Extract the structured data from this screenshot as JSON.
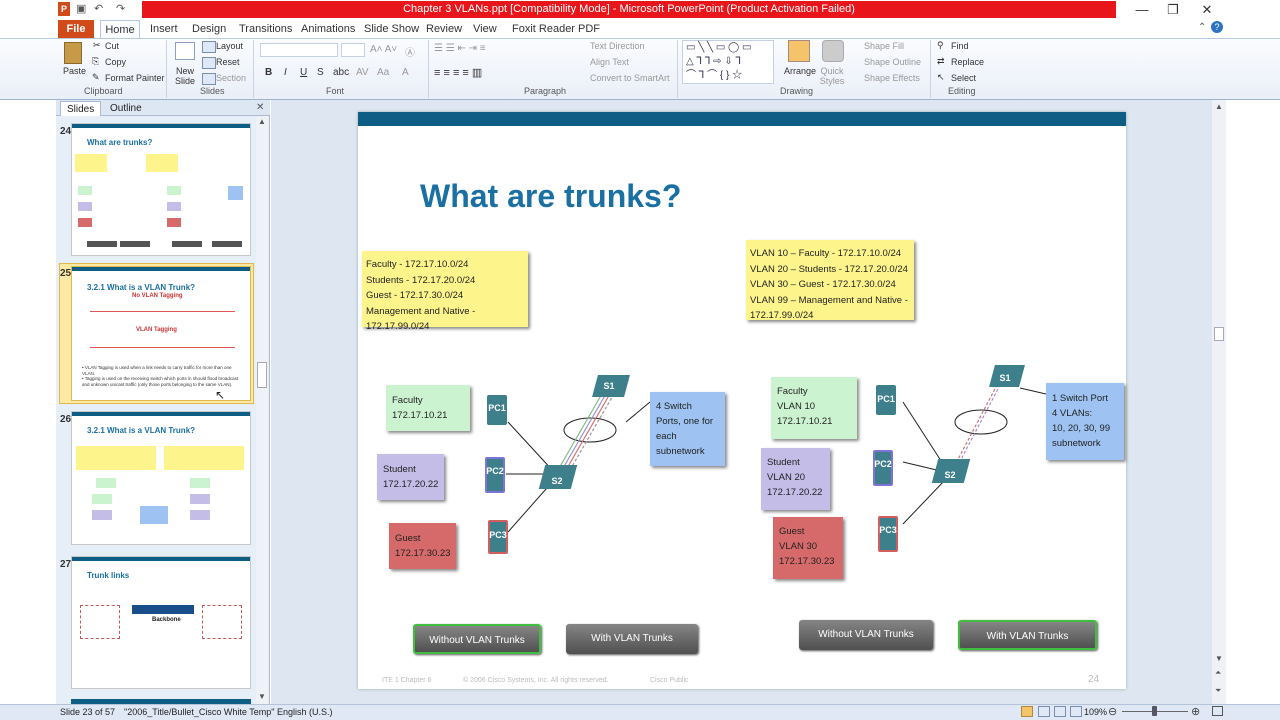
{
  "window": {
    "title": "Chapter 3 VLANs.ppt [Compatibility Mode] - Microsoft PowerPoint (Product Activation Failed)",
    "controls": [
      "—",
      "❐",
      "✕"
    ],
    "title_color": "#e8151b"
  },
  "ribbon_tabs": [
    "File",
    "Home",
    "Insert",
    "Design",
    "Transitions",
    "Animations",
    "Slide Show",
    "Review",
    "View",
    "Foxit Reader PDF"
  ],
  "clipboard": {
    "paste": "Paste",
    "cut": "Cut",
    "copy": "Copy",
    "format_painter": "Format Painter",
    "group": "Clipboard"
  },
  "slides_group": {
    "new_slide": "New Slide",
    "layout": "Layout",
    "reset": "Reset",
    "section": "Section",
    "group": "Slides"
  },
  "font_group": {
    "group": "Font",
    "bold": "B",
    "italic": "I",
    "underline": "U",
    "strike": "S",
    "shadow": "abc"
  },
  "paragraph_group": {
    "text_direction": "Text Direction",
    "align_text": "Align Text",
    "convert_smartart": "Convert to SmartArt",
    "group": "Paragraph"
  },
  "drawing_group": {
    "arrange": "Arrange",
    "quick_styles": "Quick Styles",
    "shape_fill": "Shape Fill",
    "shape_outline": "Shape Outline",
    "shape_effects": "Shape Effects",
    "group": "Drawing"
  },
  "editing_group": {
    "find": "Find",
    "replace": "Replace",
    "select": "Select",
    "group": "Editing"
  },
  "pane_tabs": [
    "Slides",
    "Outline"
  ],
  "thumbnails": [
    {
      "num": "24",
      "title": "What are trunks?"
    },
    {
      "num": "25",
      "title": "3.2.1 What is a VLAN Trunk?",
      "sub1": "No VLAN Tagging",
      "sub2": "VLAN Tagging",
      "bullets": [
        "VLAN Tagging is used when a link needs to carry traffic for more than one VLAN.",
        "Tagging is used on the receiving switch which ports in should flood broadcast and unknown unicast traffic (only those ports belonging to the same VLAN)."
      ]
    },
    {
      "num": "26",
      "title": "3.2.1 What is a VLAN Trunk?"
    },
    {
      "num": "27",
      "title": "Trunk links",
      "backbone": "Backbone"
    }
  ],
  "slide": {
    "title": "What are trunks?",
    "left_legend": [
      "Faculty - 172.17.10.0/24",
      "Students - 172.17.20.0/24",
      "Guest - 172.17.30.0/24",
      "Management and Native - 172.17.99.0/24"
    ],
    "right_legend": [
      "VLAN 10 – Faculty - 172.17.10.0/24",
      "VLAN 20 – Students - 172.17.20.0/24",
      "VLAN 30 – Guest - 172.17.30.0/24",
      "VLAN 99 – Management and Native - 172.17.99.0/24"
    ],
    "left_hosts": [
      {
        "name": "Faculty",
        "ip": "172.17.10.21"
      },
      {
        "name": "Student",
        "ip": "172.17.20.22"
      },
      {
        "name": "Guest",
        "ip": "172.17.30.23"
      }
    ],
    "right_hosts": [
      {
        "name": "Faculty",
        "vlan": "VLAN 10",
        "ip": "172.17.10.21"
      },
      {
        "name": "Student",
        "vlan": "VLAN 20",
        "ip": "172.17.20.22"
      },
      {
        "name": "Guest",
        "vlan": "VLAN 30",
        "ip": "172.17.30.23"
      }
    ],
    "left_note": [
      "4 Switch",
      "Ports, one for",
      "each",
      "subnetwork"
    ],
    "right_note": [
      "1 Switch Port",
      "4 VLANs:",
      "10, 20, 30, 99",
      "subnetwork"
    ],
    "devices": {
      "s1": "S1",
      "s2": "S2",
      "pc1": "PC1",
      "pc2": "PC2",
      "pc3": "PC3"
    },
    "buttons": {
      "without": "Without VLAN Trunks",
      "with": "With VLAN Trunks"
    },
    "footer": {
      "left": "ITE 1 Chapter 6",
      "mid": "© 2006 Cisco Systems, Inc. All rights reserved.",
      "right": "Cisco Public",
      "page": "24"
    }
  },
  "status": {
    "slide": "Slide 23 of 57",
    "theme": "\"2006_Title/Bullet_Cisco White Temp\"",
    "lang": "English (U.S.)",
    "zoom": "109%"
  }
}
